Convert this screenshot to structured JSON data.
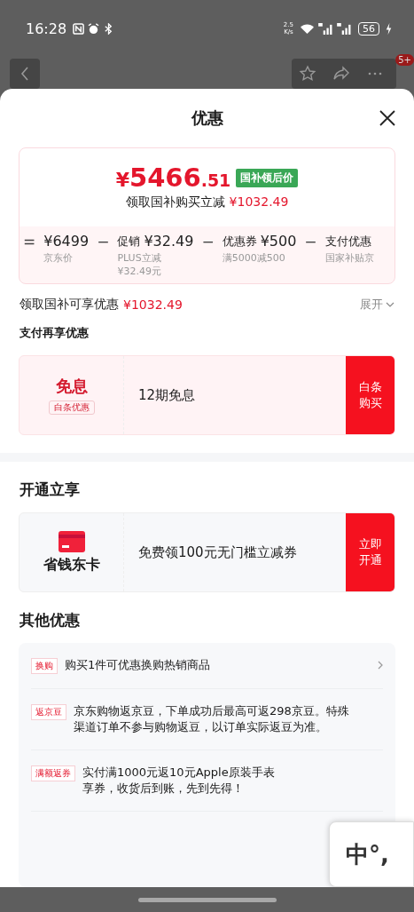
{
  "status_bar": {
    "time": "16:28",
    "speed": "2.5",
    "speed_unit": "K/s",
    "battery": "56"
  },
  "nav": {
    "badge": "5+"
  },
  "sheet": {
    "title": "优惠"
  },
  "price_card": {
    "currency": "¥",
    "price_int": "5466",
    "price_dec": ".51",
    "tag": "国补领后价",
    "subtitle": "领取国补购买立减",
    "subtitle_amount": "¥1032.49",
    "breakdown": [
      {
        "op": "=",
        "amount": "¥6499",
        "label": "京东价"
      },
      {
        "op": "−",
        "prefix": "促销",
        "amount": "¥32.49",
        "label": "PLUS立减",
        "note": "¥32.49元"
      },
      {
        "op": "−",
        "prefix": "优惠券",
        "amount": "¥500",
        "label": "满5000减500"
      },
      {
        "op": "−",
        "prefix": "支付优惠",
        "label": "国家补贴京"
      }
    ]
  },
  "subsidy": {
    "label": "领取国补可享优惠",
    "amount": "¥1032.49",
    "toggle": "展开",
    "expanded": false
  },
  "pay_section": {
    "title": "支付再享优惠",
    "card": {
      "kind": "interest",
      "headline": "免息",
      "tag": "白条优惠",
      "text": "12期免息",
      "button": "白条购买"
    }
  },
  "open_section": {
    "title": "开通立享",
    "card": {
      "kind": "membership",
      "headline": "省钱东卡",
      "text": "免费领100元无门槛立减券",
      "button": "立即开通"
    }
  },
  "other_section": {
    "title": "其他优惠",
    "rows": [
      {
        "tag": "换购",
        "lines": [
          "购买1件可优惠换购热销商品"
        ],
        "has_arrow": true
      },
      {
        "tag": "返京豆",
        "lines": [
          "京东购物返京豆，下单成功后最高可返298京豆。特殊渠道订单不参与购物返豆，以订单实际返豆为准。"
        ],
        "has_arrow": false
      },
      {
        "tag": "满额返券",
        "lines": [
          "实付满1000元返10元Apple原装手表",
          "享券，收货后到账，先到先得！"
        ],
        "has_arrow": false
      }
    ]
  },
  "ime": {
    "keys": "中°,"
  }
}
